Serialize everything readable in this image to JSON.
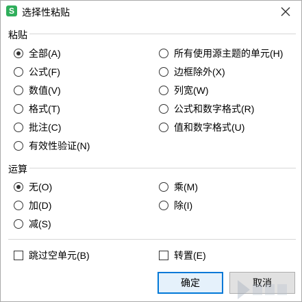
{
  "window": {
    "app_icon_letter": "S",
    "title": "选择性粘贴"
  },
  "paste": {
    "heading": "粘贴",
    "left_options": [
      {
        "label": "全部(A)",
        "checked": true
      },
      {
        "label": "公式(F)",
        "checked": false
      },
      {
        "label": "数值(V)",
        "checked": false
      },
      {
        "label": "格式(T)",
        "checked": false
      },
      {
        "label": "批注(C)",
        "checked": false
      },
      {
        "label": "有效性验证(N)",
        "checked": false
      }
    ],
    "right_options": [
      {
        "label": "所有使用源主题的单元(H)",
        "checked": false
      },
      {
        "label": "边框除外(X)",
        "checked": false
      },
      {
        "label": "列宽(W)",
        "checked": false
      },
      {
        "label": "公式和数字格式(R)",
        "checked": false
      },
      {
        "label": "值和数字格式(U)",
        "checked": false
      }
    ]
  },
  "operation": {
    "heading": "运算",
    "left_options": [
      {
        "label": "无(O)",
        "checked": true
      },
      {
        "label": "加(D)",
        "checked": false
      },
      {
        "label": "减(S)",
        "checked": false
      }
    ],
    "right_options": [
      {
        "label": "乘(M)",
        "checked": false
      },
      {
        "label": "除(I)",
        "checked": false
      }
    ]
  },
  "checkboxes": {
    "skip_blanks": {
      "label": "跳过空单元(B)",
      "checked": false
    },
    "transpose": {
      "label": "转置(E)",
      "checked": false
    }
  },
  "buttons": {
    "ok": "确定",
    "cancel": "取消"
  },
  "colors": {
    "app_icon": "#2fae5b",
    "primary_border": "#0078d7"
  }
}
